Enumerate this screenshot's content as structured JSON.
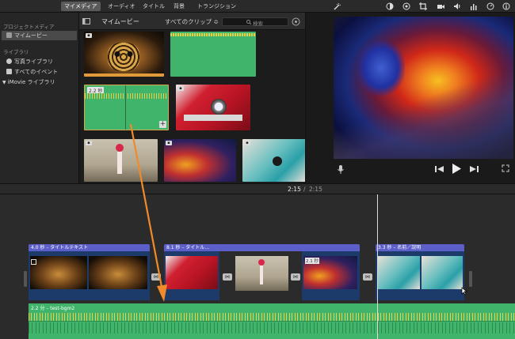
{
  "topbar": {
    "tabs": [
      {
        "label": "マイメディア",
        "active": true
      },
      {
        "label": "オーディオ",
        "active": false
      },
      {
        "label": "タイトル",
        "active": false
      },
      {
        "label": "背景",
        "active": false
      },
      {
        "label": "トランジション",
        "active": false
      }
    ]
  },
  "sidebar": {
    "project_section": "プロジェクトメディア",
    "project_item": "マイムービー",
    "library_section": "ライブラリ",
    "items": [
      "写真ライブラリ",
      "すべてのイベント",
      "iMovie ライブラリ"
    ]
  },
  "browser": {
    "title": "マイムービー",
    "filter": "すべてのクリップ ≎",
    "search_placeholder": "検索",
    "clip_duration": "2.2 秒"
  },
  "timeline": {
    "time_current": "2:15",
    "time_sep": "/",
    "time_total": "2:15",
    "title_clip_1": "4.0 秒 – タイトルテキスト",
    "title_clip_2": "8.1 秒 – タイトル…",
    "title_clip_3": "3.3 秒 – 名前／説明",
    "clip_duration": "2.1 秒",
    "audio_label": "2.2 分 – test-bgm2"
  },
  "colors": {
    "accent_orange": "#f08a2a",
    "audio_green": "#3fb46a",
    "title_purple": "#5d5fc9"
  }
}
